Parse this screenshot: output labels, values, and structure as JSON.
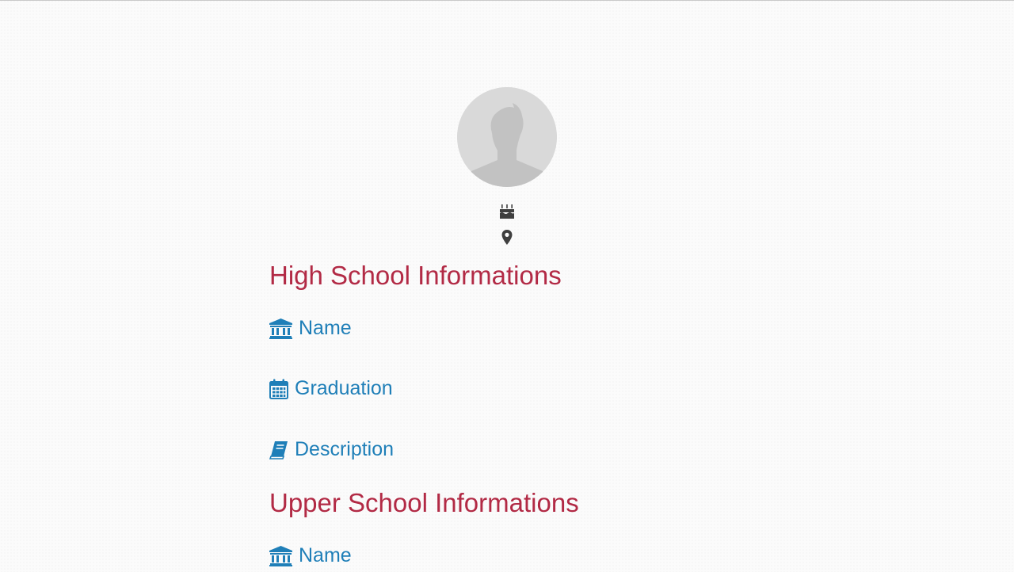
{
  "profile": {
    "avatar_icon": "user-silhouette-icon",
    "birthday_icon": "birthday-cake-icon",
    "location_icon": "map-marker-icon"
  },
  "sections": [
    {
      "title": "High School Informations",
      "fields": [
        {
          "label": "Name",
          "icon": "institution-icon"
        },
        {
          "label": "Graduation",
          "icon": "calendar-icon"
        },
        {
          "label": "Description",
          "icon": "book-icon"
        }
      ]
    },
    {
      "title": "Upper School Informations",
      "fields": [
        {
          "label": "Name",
          "icon": "institution-icon"
        }
      ]
    }
  ],
  "colors": {
    "section_title": "#b22a45",
    "field_label": "#1f7fb8",
    "meta_icon": "#3f3f3f"
  }
}
